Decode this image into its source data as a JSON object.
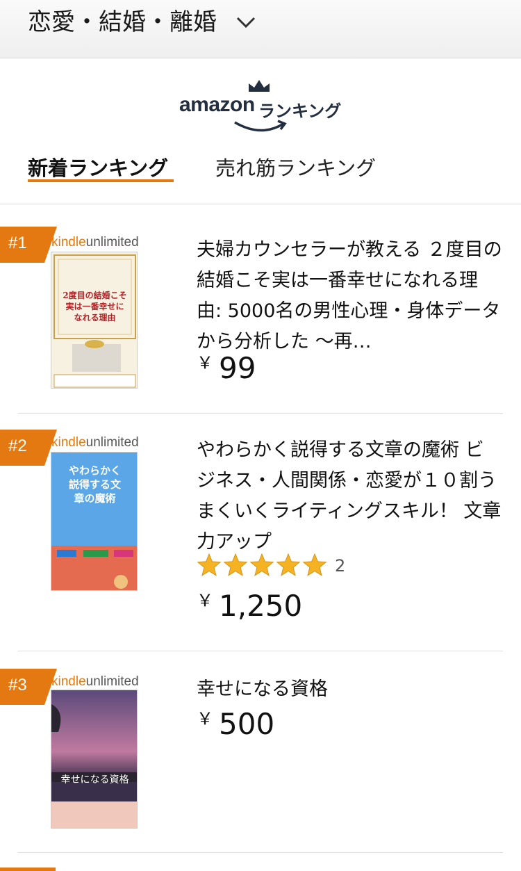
{
  "header": {
    "category": "恋愛・結婚・離婚"
  },
  "logo": {
    "brand": "amazon",
    "suffix": "ランキング"
  },
  "tabs": [
    {
      "label": "新着ランキング",
      "active": true
    },
    {
      "label": "売れ筋ランキング",
      "active": false
    }
  ],
  "items": [
    {
      "rank": "#1",
      "kindle_prefix": "kindle",
      "kindle_suffix": "unlimited",
      "title": "夫婦カウンセラーが教える ２度目の結婚こそ実は一番幸せになれる理由: 5000名の男性心理・身体データから分析した ～再…",
      "price_currency": "￥",
      "price": "99",
      "cover_text": "2度目の結婚こそ実は一番幸せになれる理由"
    },
    {
      "rank": "#2",
      "kindle_prefix": "kindle",
      "kindle_suffix": "unlimited",
      "title": "やわらかく説得する文章の魔術 ビジネス・人間関係・恋愛が１０割うまくいくライティングスキル！ 文章力アップ",
      "rating": 5,
      "review_count": "2",
      "price_currency": "￥",
      "price": "1,250",
      "cover_text": "やわらかく説得する文章の魔術"
    },
    {
      "rank": "#3",
      "kindle_prefix": "kindle",
      "kindle_suffix": "unlimited",
      "title": "幸せになる資格",
      "price_currency": "￥",
      "price": "500",
      "cover_text": "幸せになる資格"
    }
  ],
  "colors": {
    "accent": "#e47911",
    "star": "#f5b323",
    "logo": "#232f3e"
  }
}
